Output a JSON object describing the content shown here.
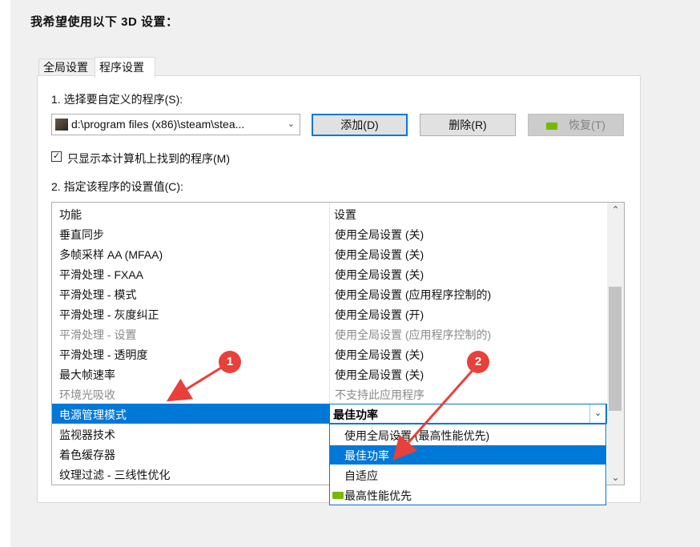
{
  "heading": "我希望使用以下 3D 设置：",
  "tabs": {
    "global": "全局设置",
    "program": "程序设置"
  },
  "step1_label": "1. 选择要自定义的程序(S):",
  "program_select": {
    "value": "d:\\program files (x86)\\steam\\stea...",
    "arrow": "⌄"
  },
  "buttons": {
    "add": "添加(D)",
    "remove": "删除(R)",
    "restore": "恢复(T)"
  },
  "show_only_checkbox": {
    "label": "只显示本计算机上找到的程序(M)",
    "checked": true,
    "mark": "✓"
  },
  "step2_label": "2. 指定该程序的设置值(C):",
  "grid": {
    "headers": {
      "feature": "功能",
      "setting": "设置"
    },
    "rows": [
      {
        "feature": "垂直同步",
        "setting": "使用全局设置 (关)",
        "disabled": false
      },
      {
        "feature": "多帧采样 AA (MFAA)",
        "setting": "使用全局设置 (关)",
        "disabled": false
      },
      {
        "feature": "平滑处理 - FXAA",
        "setting": "使用全局设置 (关)",
        "disabled": false
      },
      {
        "feature": "平滑处理 - 模式",
        "setting": "使用全局设置 (应用程序控制的)",
        "disabled": false
      },
      {
        "feature": "平滑处理 - 灰度纠正",
        "setting": "使用全局设置 (开)",
        "disabled": false
      },
      {
        "feature": "平滑处理 - 设置",
        "setting": "使用全局设置 (应用程序控制的)",
        "disabled": true
      },
      {
        "feature": "平滑处理 - 透明度",
        "setting": "使用全局设置 (关)",
        "disabled": false
      },
      {
        "feature": "最大帧速率",
        "setting": "使用全局设置 (关)",
        "disabled": false
      },
      {
        "feature": "环境光吸收",
        "setting": "不支持此应用程序",
        "disabled": true
      },
      {
        "feature": "电源管理模式",
        "setting": "最佳功率",
        "selected": true
      },
      {
        "feature": "监视器技术",
        "setting": ""
      },
      {
        "feature": "着色缓存器",
        "setting": ""
      },
      {
        "feature": "纹理过滤 - 三线性优化",
        "setting": ""
      }
    ],
    "combo_arrow": "⌄",
    "scroll_up": "⌃",
    "scroll_down": "⌄"
  },
  "dropdown_options": [
    {
      "label": "使用全局设置 (最高性能优先)",
      "highlighted": false,
      "nv_icon": false
    },
    {
      "label": "最佳功率",
      "highlighted": true,
      "nv_icon": false
    },
    {
      "label": "自适应",
      "highlighted": false,
      "nv_icon": false
    },
    {
      "label": "最高性能优先",
      "highlighted": false,
      "nv_icon": true
    }
  ],
  "annotations": {
    "badge1": "1",
    "badge2": "2",
    "color": "#e8403a"
  },
  "colors": {
    "selection": "#0078d7",
    "nvidia_green": "#76b900"
  }
}
